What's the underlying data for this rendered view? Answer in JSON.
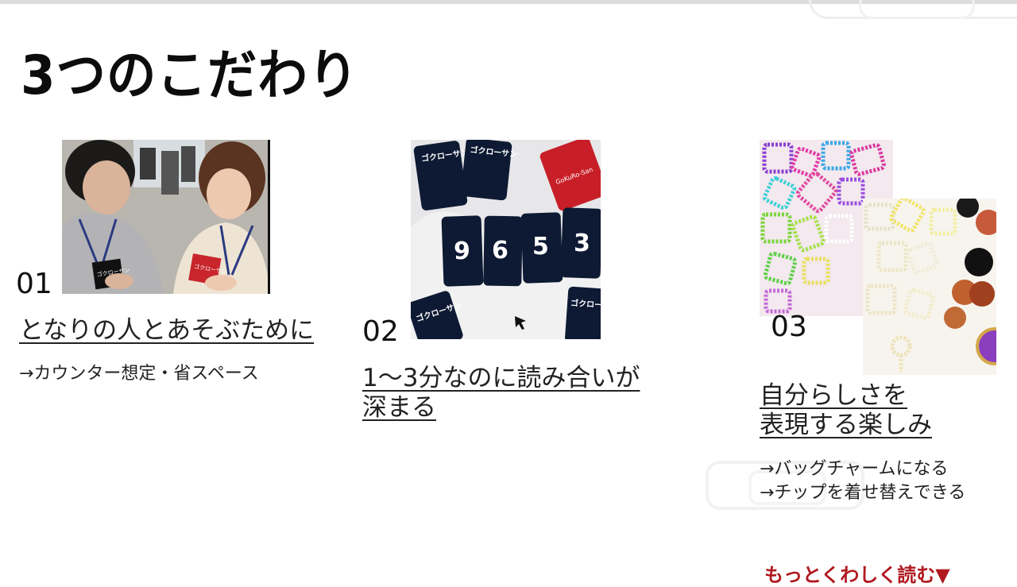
{
  "page": {
    "title": "3つのこだわり",
    "more_link": "もっとくわしく読む▼"
  },
  "features": [
    {
      "number": "01",
      "heading": "となりの人とあそぶために",
      "note": "→カウンター想定・省スペース",
      "photo": {
        "card_text_left": "ゴクローサン",
        "card_text_right": "ゴクローサン"
      }
    },
    {
      "number": "02",
      "heading": "1～3分なのに読み合いが\n深まる",
      "photo": {
        "card_label": "ゴクローサン",
        "red_card_label": "GoKuRo-San",
        "digits": [
          "9",
          "6",
          "5",
          "3"
        ]
      }
    },
    {
      "number": "03",
      "heading": "自分らしさを\n表現する楽しみ",
      "note": "→バッグチャームになる\n→チップを着せ替えできる"
    }
  ],
  "colors": {
    "accent_red": "#b0181e",
    "card_navy": "#0e1a33",
    "card_red": "#c81e28"
  }
}
